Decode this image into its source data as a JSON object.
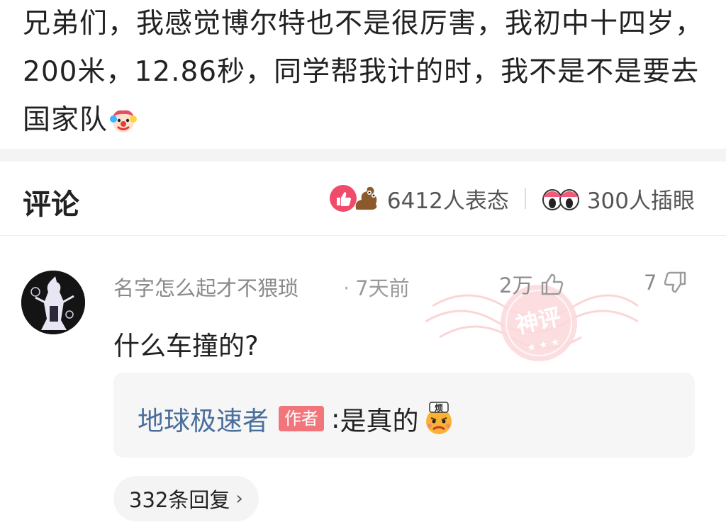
{
  "post": {
    "text": "兄弟们，我感觉博尔特也不是很厉害，我初中十四岁，200米，12.86秒，同学帮我计的时，我不是不是要去国家队",
    "emoji_icon": "clown-face-icon"
  },
  "comments_section": {
    "title": "评论",
    "reaction_icons": [
      "thumbs-up-icon",
      "poop-emoji-icon"
    ],
    "reaction_count": "6412人表态",
    "peek_icon": "peeking-eyes-icon",
    "peek_count": "300人插眼"
  },
  "comment": {
    "username": "名字怎么起才不猥琐",
    "dot": "·",
    "time": "7天前",
    "likes": "2万",
    "dislikes": "7",
    "stamp_text": "神评",
    "text": "什么车撞的?",
    "reply": {
      "author": "地球极速者",
      "badge": "作者",
      "colon": ":",
      "text": "是真的",
      "emoji_icon": "annoyed-face-icon",
      "emoji_caption": "烦"
    },
    "replies_link": "332条回复",
    "replies_chevron": "›"
  },
  "colors": {
    "accent_red": "#f1767c",
    "author_blue": "#4a6f9c",
    "muted_gray": "#8a8a8a",
    "reply_bg": "#f6f6f6"
  }
}
